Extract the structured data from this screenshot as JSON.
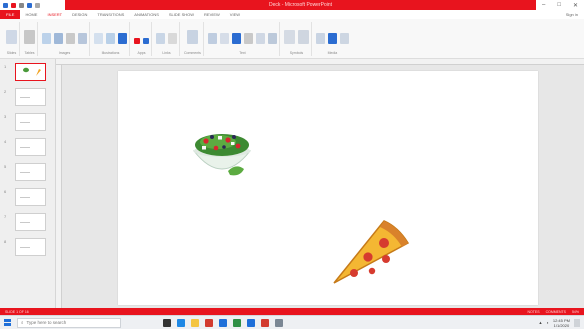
{
  "titlebar": {
    "title": "Deck - Microsoft PowerPoint",
    "min": "–",
    "restore": "□",
    "close": "✕"
  },
  "tabs": [
    {
      "label": "FILE"
    },
    {
      "label": "HOME"
    },
    {
      "label": "INSERT"
    },
    {
      "label": "DESIGN"
    },
    {
      "label": "TRANSITIONS"
    },
    {
      "label": "ANIMATIONS"
    },
    {
      "label": "SLIDE SHOW"
    },
    {
      "label": "REVIEW"
    },
    {
      "label": "VIEW"
    }
  ],
  "signin": "Sign in",
  "ribbon_groups": [
    {
      "label": "Slides"
    },
    {
      "label": "Tables"
    },
    {
      "label": "Images"
    },
    {
      "label": "Illustrations"
    },
    {
      "label": "Apps"
    },
    {
      "label": "Links"
    },
    {
      "label": "Comments"
    },
    {
      "label": "Text"
    },
    {
      "label": "Symbols"
    },
    {
      "label": "Media"
    }
  ],
  "thumbnails": [
    {
      "num": "1"
    },
    {
      "num": "2"
    },
    {
      "num": "3"
    },
    {
      "num": "4"
    },
    {
      "num": "5"
    },
    {
      "num": "6"
    },
    {
      "num": "7"
    },
    {
      "num": "8"
    }
  ],
  "slide": {
    "images": [
      {
        "name": "salad-bowl"
      },
      {
        "name": "pizza-slice"
      }
    ]
  },
  "statusbar": {
    "left": "SLIDE 1 OF 16",
    "notes": "NOTES",
    "comments": "COMMENTS",
    "zoom": "54%"
  },
  "taskbar": {
    "search_placeholder": "Type here to search",
    "time": "12:45 PM",
    "date": "1/1/2020"
  },
  "colors": {
    "accent": "#e8141e"
  }
}
